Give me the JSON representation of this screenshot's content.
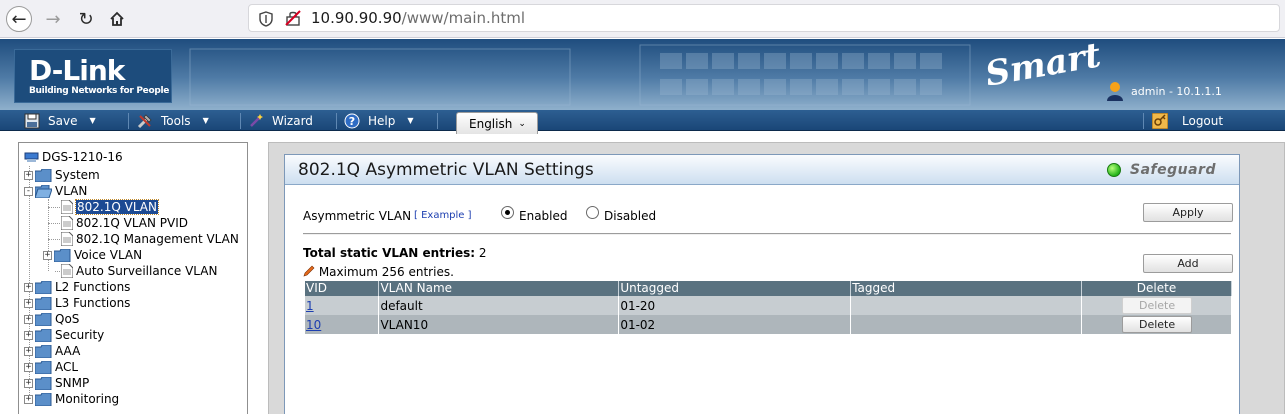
{
  "browser": {
    "url_host": "10.90.90.90",
    "url_path": "/www/main.html"
  },
  "header": {
    "logo_text": "D-Link",
    "logo_tagline": "Building Networks for People",
    "product_logo": "Smart",
    "user_info": "admin - 10.1.1.1"
  },
  "menu": {
    "save": "Save",
    "tools": "Tools",
    "wizard": "Wizard",
    "help": "Help",
    "language": "English",
    "logout": "Logout"
  },
  "tree": {
    "root": "DGS-1210-16",
    "items": [
      {
        "label": "System"
      },
      {
        "label": "VLAN"
      },
      {
        "label": "802.1Q VLAN"
      },
      {
        "label": "802.1Q VLAN PVID"
      },
      {
        "label": "802.1Q Management VLAN"
      },
      {
        "label": "Voice VLAN"
      },
      {
        "label": "Auto Surveillance VLAN"
      },
      {
        "label": "L2 Functions"
      },
      {
        "label": "L3 Functions"
      },
      {
        "label": "QoS"
      },
      {
        "label": "Security"
      },
      {
        "label": "AAA"
      },
      {
        "label": "ACL"
      },
      {
        "label": "SNMP"
      },
      {
        "label": "Monitoring"
      }
    ]
  },
  "panel": {
    "title": "802.1Q Asymmetric VLAN Settings",
    "safeguard": "Safeguard",
    "asym_label": "Asymmetric VLAN",
    "example_link": "[ Example ]",
    "enabled_label": "Enabled",
    "disabled_label": "Disabled",
    "asym_state": "Enabled",
    "apply_label": "Apply",
    "total_label": "Total static VLAN entries:",
    "total_value": "2",
    "max_note": "Maximum 256 entries.",
    "add_label": "Add"
  },
  "table": {
    "headers": [
      "VID",
      "VLAN Name",
      "Untagged",
      "Tagged",
      "Delete"
    ],
    "rows": [
      {
        "vid": "1",
        "name": "default",
        "untagged": "01-20",
        "tagged": "",
        "delete": "Delete",
        "delete_enabled": false
      },
      {
        "vid": "10",
        "name": "VLAN10",
        "untagged": "01-02",
        "tagged": "",
        "delete": "Delete",
        "delete_enabled": true
      }
    ]
  }
}
